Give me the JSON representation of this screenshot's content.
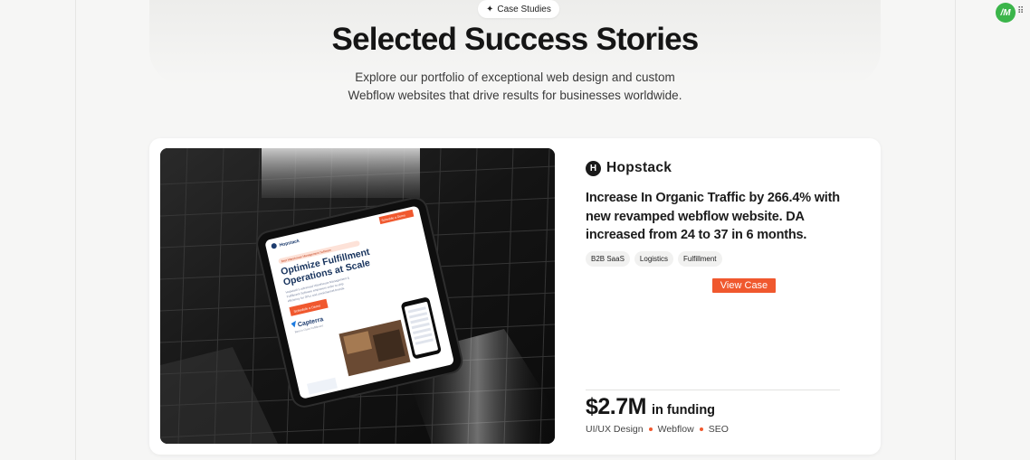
{
  "header": {
    "eyebrow": "Case Studies",
    "title": "Selected Success Stories",
    "subtitle_line1": "Explore our portfolio of exceptional web design and custom",
    "subtitle_line2": "Webflow websites that drive results for businesses worldwide."
  },
  "case": {
    "brand": "Hopstack",
    "headline": "Increase In Organic Traffic by 266.4% with new revamped webflow website. DA increased from 24 to 37 in 6 months.",
    "tags": [
      "B2B SaaS",
      "Logistics",
      "Fulfillment"
    ],
    "cta": "View Case",
    "stat_value": "$2.7M",
    "stat_label": "in funding",
    "services": [
      "UI/UX Design",
      "Webflow",
      "SEO"
    ],
    "image": {
      "brand": "Hopstack",
      "cta_top": "Schedule a Demo",
      "badge": "Best Warehouse Management Software",
      "headline_line1": "Optimize Fulfillment",
      "headline_line2": "Operations at Scale",
      "body_line1": "Hopstack's advanced Warehouse Management &",
      "body_line2": "Fulfillment Software empowers order to ship",
      "body_line3": "efficiency for 3PLs and omnichannel brands.",
      "cta": "Schedule a Demo",
      "review": "Capterra",
      "review_sub": "Best in Class Fulfillment"
    }
  },
  "widget": {
    "initials": "/M",
    "menu_icon": "grip-dots-icon"
  },
  "colors": {
    "accent": "#f0582e",
    "card": "#ffffff",
    "background": "#f6f6f5",
    "avatar": "#3bb54a"
  }
}
